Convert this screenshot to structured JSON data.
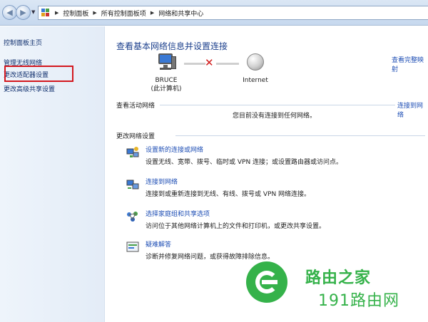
{
  "address_bar": {
    "crumbs": [
      "控制面板",
      "所有控制面板项",
      "网络和共享中心"
    ]
  },
  "left_pane": {
    "home": "控制面板主页",
    "items": [
      "管理无线网络",
      "更改适配器设置",
      "更改高级共享设置"
    ],
    "highlight_color": "#d3171e"
  },
  "main": {
    "title": "查看基本网络信息并设置连接",
    "view_full_map": "查看完整映射",
    "computer_name": "BRUCE",
    "computer_subtitle": "(此计算机)",
    "internet_label": "Internet",
    "active_networks_head": "查看活动网络",
    "connect_link": "连接到网络",
    "no_connection": "您目前没有连接到任何网络。",
    "change_settings_head": "更改网络设置",
    "tasks": [
      {
        "link": "设置新的连接或网络",
        "desc": "设置无线、宽带、拨号、临时或 VPN 连接；或设置路由器或访问点。",
        "icon": "new-connection-icon"
      },
      {
        "link": "连接到网络",
        "desc": "连接到或重新连接到无线、有线、拨号或 VPN 网络连接。",
        "icon": "connect-network-icon"
      },
      {
        "link": "选择家庭组和共享选项",
        "desc": "访问位于其他网络计算机上的文件和打印机，或更改共享设置。",
        "icon": "homegroup-icon"
      },
      {
        "link": "疑难解答",
        "desc": "诊断并修复网络问题，或获得故障排除信息。",
        "icon": "troubleshoot-icon"
      }
    ]
  },
  "watermark": {
    "line1": "路由之家",
    "line2": "191路由网",
    "color": "#35b24a"
  }
}
